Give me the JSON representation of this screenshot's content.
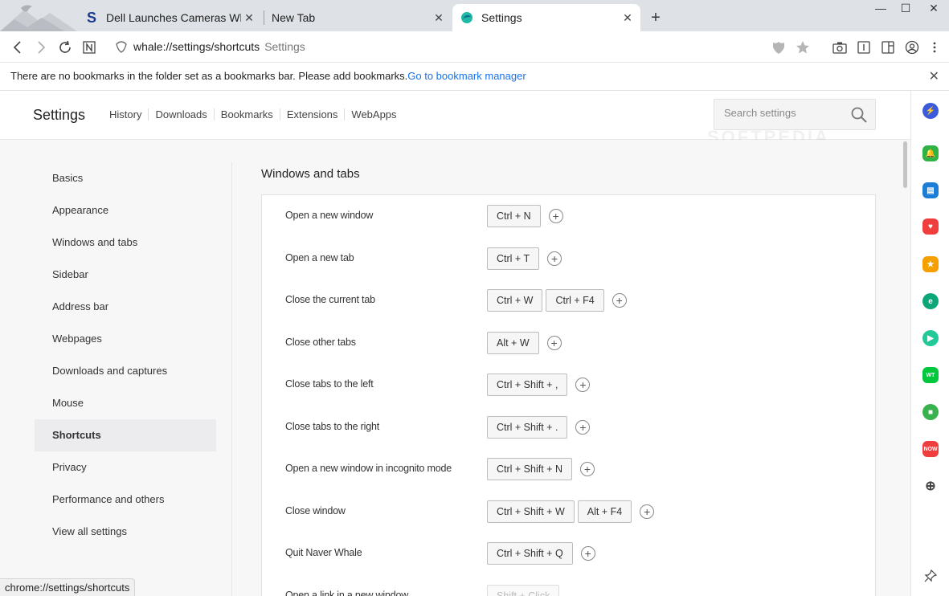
{
  "tabs": [
    {
      "title": "Dell Launches Cameras Whose",
      "favicon": "softpedia-s-icon"
    },
    {
      "title": "New Tab",
      "favicon": ""
    },
    {
      "title": "Settings",
      "favicon": "whale-icon"
    }
  ],
  "address_bar": {
    "url": "whale://settings/shortcuts",
    "page_title": "Settings"
  },
  "bookmark_bar": {
    "message": "There are no bookmarks in the folder set as a bookmarks bar. Please add bookmarks.",
    "link": "Go to bookmark manager"
  },
  "settings": {
    "title": "Settings",
    "nav": [
      "History",
      "Downloads",
      "Bookmarks",
      "Extensions",
      "WebApps"
    ],
    "search_placeholder": "Search settings"
  },
  "sidebar": {
    "items": [
      "Basics",
      "Appearance",
      "Windows and tabs",
      "Sidebar",
      "Address bar",
      "Webpages",
      "Downloads and captures",
      "Mouse",
      "Shortcuts",
      "Privacy",
      "Performance and others",
      "View all settings"
    ],
    "active": "Shortcuts"
  },
  "section": {
    "title": "Windows and tabs",
    "shortcuts": [
      {
        "label": "Open a new window",
        "keys": [
          "Ctrl + N"
        ]
      },
      {
        "label": "Open a new tab",
        "keys": [
          "Ctrl + T"
        ]
      },
      {
        "label": "Close the current tab",
        "keys": [
          "Ctrl + W",
          "Ctrl + F4"
        ]
      },
      {
        "label": "Close other tabs",
        "keys": [
          "Alt + W"
        ]
      },
      {
        "label": "Close tabs to the left",
        "keys": [
          "Ctrl + Shift + ,"
        ]
      },
      {
        "label": "Close tabs to the right",
        "keys": [
          "Ctrl + Shift + ."
        ]
      },
      {
        "label": "Open a new window in incognito mode",
        "keys": [
          "Ctrl + Shift + N"
        ]
      },
      {
        "label": "Close window",
        "keys": [
          "Ctrl + Shift + W",
          "Alt + F4"
        ]
      },
      {
        "label": "Quit Naver Whale",
        "keys": [
          "Ctrl + Shift + Q"
        ]
      },
      {
        "label": "Open a link in a new window",
        "keys": [
          "Shift + Click"
        ]
      }
    ]
  },
  "watermark": "SOFTPEDIA",
  "status_bar": "chrome://settings/shortcuts",
  "right_sidebar_apps": [
    {
      "name": "lightning-app-icon",
      "color": "#3b5bdb"
    },
    {
      "name": "bell-app-icon",
      "color": "#2fb344"
    },
    {
      "name": "wallet-app-icon",
      "color": "#1c7ed6"
    },
    {
      "name": "pocket-app-icon",
      "color": "#f03e3e"
    },
    {
      "name": "star-app-icon",
      "color": "#f59f00"
    },
    {
      "name": "translate-app-icon",
      "color": "#0ca678"
    },
    {
      "name": "play-app-icon",
      "color": "#20c997"
    },
    {
      "name": "webtoon-app-icon",
      "color": "#00c73c"
    },
    {
      "name": "green-square-app-icon",
      "color": "#37b24d"
    },
    {
      "name": "now-app-icon",
      "color": "#f03e3e"
    }
  ]
}
